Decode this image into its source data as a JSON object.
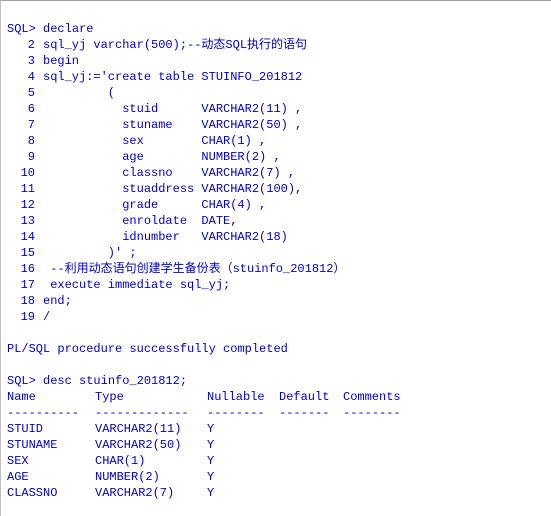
{
  "prompt": "SQL>",
  "code": {
    "l1": "declare",
    "l2": "sql_yj varchar(500);--动态SQL执行的语句",
    "l3": "begin",
    "l4": "sql_yj:='create table STUINFO_201812",
    "l5": "         (",
    "l6": "           stuid      VARCHAR2(11) ,",
    "l7": "           stuname    VARCHAR2(50) ,",
    "l8": "           sex        CHAR(1) ,",
    "l9": "           age        NUMBER(2) ,",
    "l10": "           classno    VARCHAR2(7) ,",
    "l11": "           stuaddress VARCHAR2(100),",
    "l12": "           grade      CHAR(4) ,",
    "l13": "           enroldate  DATE,",
    "l14": "           idnumber   VARCHAR2(18)",
    "l15": "         )' ;",
    "l16": " --利用动态语句创建学生备份表（stuinfo_201812）",
    "l17": " execute immediate sql_yj;",
    "l18": "end;",
    "l19": "/"
  },
  "result_line": "PL/SQL procedure successfully completed",
  "desc_cmd": "desc stuinfo_201812;",
  "tbl": {
    "hdr": {
      "name": "Name",
      "type": "Type",
      "nullable": "Nullable",
      "default": "Default",
      "comments": "Comments"
    },
    "sep": {
      "name": "----------",
      "type": "-------------",
      "nullable": "--------",
      "default": "-------",
      "comments": "--------"
    },
    "rows": [
      {
        "name": "STUID",
        "type": "VARCHAR2(11)",
        "nullable": "Y"
      },
      {
        "name": "STUNAME",
        "type": "VARCHAR2(50)",
        "nullable": "Y"
      },
      {
        "name": "SEX",
        "type": "CHAR(1)",
        "nullable": "Y"
      },
      {
        "name": "AGE",
        "type": "NUMBER(2)",
        "nullable": "Y"
      },
      {
        "name": "CLASSNO",
        "type": "VARCHAR2(7)",
        "nullable": "Y"
      }
    ]
  }
}
